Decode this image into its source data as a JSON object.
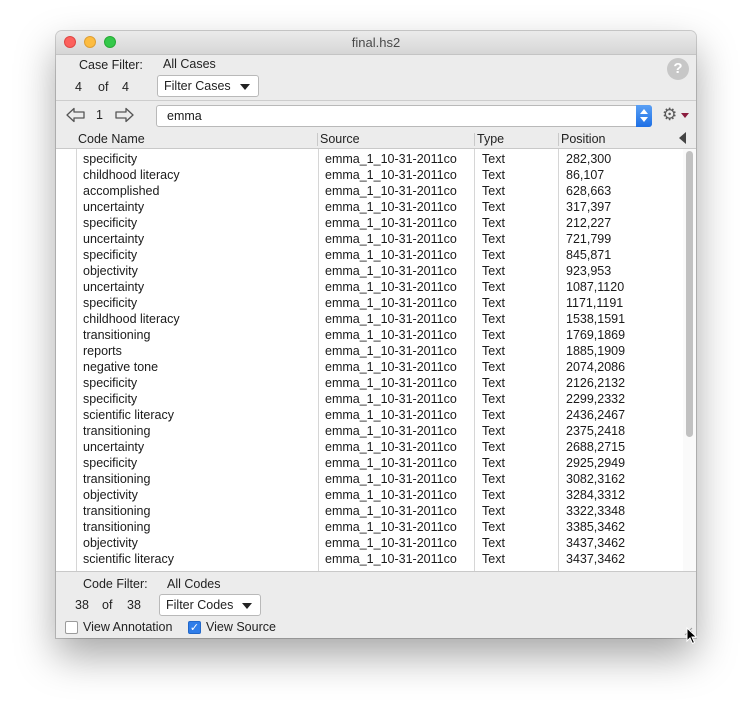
{
  "window": {
    "title": "final.hs2"
  },
  "case_filter": {
    "label": "Case Filter:",
    "value": "All Cases",
    "count": "4",
    "of": "of",
    "total": "4",
    "button_label": "Filter Cases"
  },
  "nav": {
    "index": "1",
    "search_value": "emma"
  },
  "table": {
    "columns": [
      "Code Name",
      "Source",
      "Type",
      "Position"
    ],
    "rows": [
      [
        "specificity",
        "emma_1_10-31-2011co",
        "Text",
        "282,300"
      ],
      [
        "childhood literacy",
        "emma_1_10-31-2011co",
        "Text",
        "86,107"
      ],
      [
        "accomplished",
        "emma_1_10-31-2011co",
        "Text",
        "628,663"
      ],
      [
        "uncertainty",
        "emma_1_10-31-2011co",
        "Text",
        "317,397"
      ],
      [
        "specificity",
        "emma_1_10-31-2011co",
        "Text",
        "212,227"
      ],
      [
        "uncertainty",
        "emma_1_10-31-2011co",
        "Text",
        "721,799"
      ],
      [
        "specificity",
        "emma_1_10-31-2011co",
        "Text",
        "845,871"
      ],
      [
        "objectivity",
        "emma_1_10-31-2011co",
        "Text",
        "923,953"
      ],
      [
        "uncertainty",
        "emma_1_10-31-2011co",
        "Text",
        "1087,1120"
      ],
      [
        "specificity",
        "emma_1_10-31-2011co",
        "Text",
        "1171,1191"
      ],
      [
        "childhood literacy",
        "emma_1_10-31-2011co",
        "Text",
        "1538,1591"
      ],
      [
        "transitioning",
        "emma_1_10-31-2011co",
        "Text",
        "1769,1869"
      ],
      [
        "reports",
        "emma_1_10-31-2011co",
        "Text",
        "1885,1909"
      ],
      [
        "negative tone",
        "emma_1_10-31-2011co",
        "Text",
        "2074,2086"
      ],
      [
        "specificity",
        "emma_1_10-31-2011co",
        "Text",
        "2126,2132"
      ],
      [
        "specificity",
        "emma_1_10-31-2011co",
        "Text",
        "2299,2332"
      ],
      [
        "scientific literacy",
        "emma_1_10-31-2011co",
        "Text",
        "2436,2467"
      ],
      [
        "transitioning",
        "emma_1_10-31-2011co",
        "Text",
        "2375,2418"
      ],
      [
        "uncertainty",
        "emma_1_10-31-2011co",
        "Text",
        "2688,2715"
      ],
      [
        "specificity",
        "emma_1_10-31-2011co",
        "Text",
        "2925,2949"
      ],
      [
        "transitioning",
        "emma_1_10-31-2011co",
        "Text",
        "3082,3162"
      ],
      [
        "objectivity",
        "emma_1_10-31-2011co",
        "Text",
        "3284,3312"
      ],
      [
        "transitioning",
        "emma_1_10-31-2011co",
        "Text",
        "3322,3348"
      ],
      [
        "transitioning",
        "emma_1_10-31-2011co",
        "Text",
        "3385,3462"
      ],
      [
        "objectivity",
        "emma_1_10-31-2011co",
        "Text",
        "3437,3462"
      ],
      [
        "scientific literacy",
        "emma_1_10-31-2011co",
        "Text",
        "3437,3462"
      ]
    ]
  },
  "code_filter": {
    "label": "Code Filter:",
    "value": "All Codes",
    "count": "38",
    "of": "of",
    "total": "38",
    "button_label": "Filter Codes"
  },
  "options": {
    "view_annotation": {
      "label": "View Annotation",
      "checked": false
    },
    "view_source": {
      "label": "View Source",
      "checked": true
    }
  },
  "colors": {
    "accent": "#2f7de9",
    "close": "#fc615d",
    "minimize": "#fdbc40",
    "maximize": "#34c84a"
  },
  "icons": {
    "help": "question-mark-icon",
    "back": "left-arrow-icon",
    "forward": "right-arrow-icon",
    "settings": "gear-icon"
  }
}
